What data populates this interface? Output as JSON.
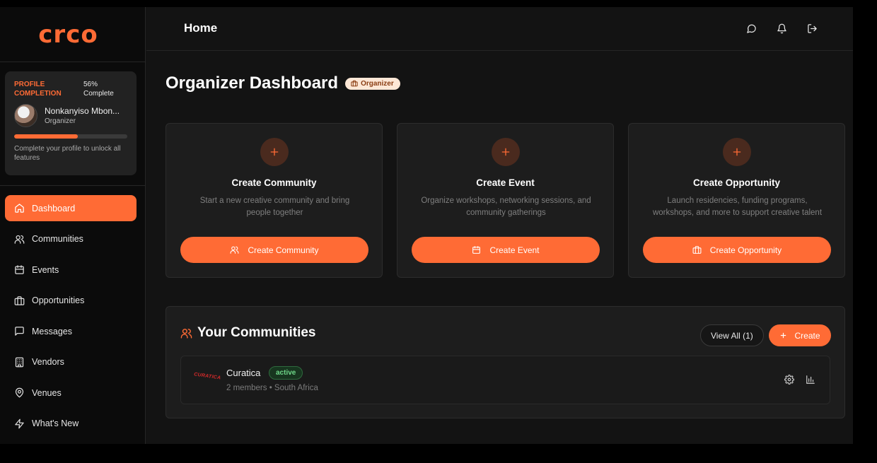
{
  "brand": {
    "logo_text": "crco",
    "accent": "#ff6b35"
  },
  "profile": {
    "completion_label": "PROFILE COMPLETION",
    "completion_text": "56% Complete",
    "completion_value": 56,
    "name": "Nonkanyiso Mbon...",
    "role": "Organizer",
    "hint": "Complete your profile to unlock all features"
  },
  "sidebar": {
    "items": [
      {
        "label": "Dashboard",
        "icon": "home-icon",
        "active": true
      },
      {
        "label": "Communities",
        "icon": "users-icon"
      },
      {
        "label": "Events",
        "icon": "calendar-icon"
      },
      {
        "label": "Opportunities",
        "icon": "briefcase-icon"
      },
      {
        "label": "Messages",
        "icon": "message-icon"
      },
      {
        "label": "Vendors",
        "icon": "building-icon"
      },
      {
        "label": "Venues",
        "icon": "map-pin-icon"
      },
      {
        "label": "What's New",
        "icon": "zap-icon"
      }
    ]
  },
  "header": {
    "title": "Home",
    "icons": [
      "chat-icon",
      "bell-icon",
      "logout-icon"
    ]
  },
  "dashboard": {
    "title": "Organizer Dashboard",
    "badge": "Organizer"
  },
  "cards": [
    {
      "title": "Create Community",
      "description": "Start a new creative community and bring people together",
      "button": "Create Community",
      "button_icon": "users-icon"
    },
    {
      "title": "Create Event",
      "description": "Organize workshops, networking sessions, and community gatherings",
      "button": "Create Event",
      "button_icon": "calendar-icon"
    },
    {
      "title": "Create Opportunity",
      "description": "Launch residencies, funding programs, workshops, and more to support creative talent",
      "button": "Create Opportunity",
      "button_icon": "briefcase-icon"
    }
  ],
  "communities": {
    "title": "Your Communities",
    "view_all": "View All (1)",
    "create": "Create",
    "items": [
      {
        "logo_text": "CURATICA",
        "name": "Curatica",
        "status": "active",
        "meta": "2 members • South Africa"
      }
    ]
  }
}
